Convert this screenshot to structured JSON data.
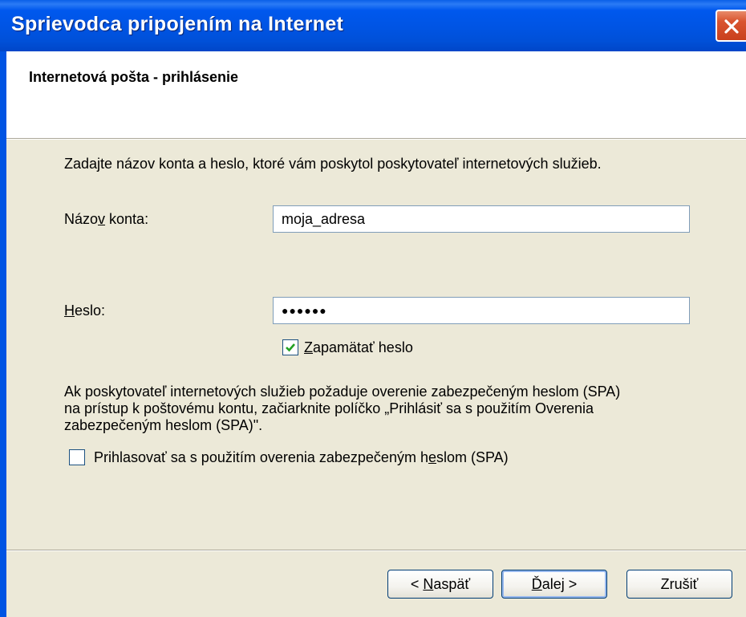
{
  "window": {
    "title": "Sprievodca pripojením na Internet"
  },
  "header": {
    "title": "Internetová pošta - prihlásenie"
  },
  "content": {
    "intro": "Zadajte názov konta a heslo, ktoré vám poskytol poskytovateľ internetových služieb.",
    "account_label_pre": "Názo",
    "account_label_key": "v",
    "account_label_post": " konta:",
    "account_value": "moja_adresa",
    "password_label_key": "H",
    "password_label_post": "eslo:",
    "password_value": "●●●●●●",
    "remember_key": "Z",
    "remember_rest": "apamätať heslo",
    "remember_checked": true,
    "spa_text_line1": "Ak poskytovateľ internetových služieb požaduje overenie zabezpečeným heslom (SPA)",
    "spa_text_line2": "na prístup k poštovému kontu, začiarknite políčko „Prihlásiť sa s použitím Overenia",
    "spa_text_line3": "zabezpečeným heslom (SPA)\".",
    "spa_checkbox_pre": "Prihlasovať sa s použitím overenia zabezpečeným h",
    "spa_checkbox_key": "e",
    "spa_checkbox_post": "slom (SPA)",
    "spa_checked": false
  },
  "buttons": {
    "back_pre": "< ",
    "back_key": "N",
    "back_post": "aspäť",
    "next_key": "Ď",
    "next_post": "alej >",
    "cancel": "Zrušiť"
  }
}
